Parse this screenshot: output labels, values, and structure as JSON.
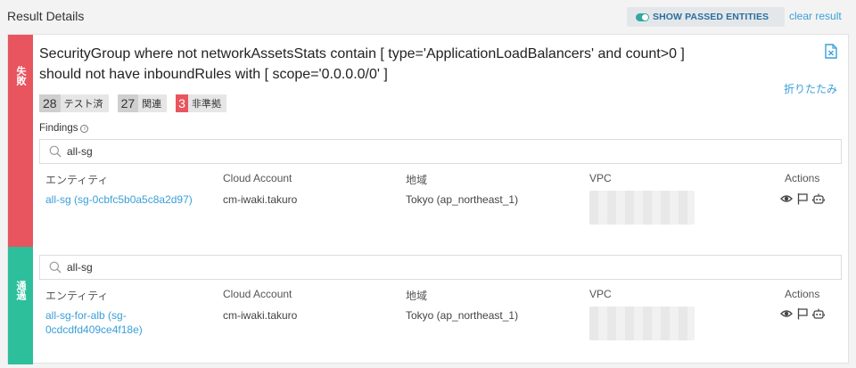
{
  "header": {
    "title": "Result Details",
    "show_passed_label": "SHOW PASSED ENTITIES",
    "clear_label": "clear result"
  },
  "rule": {
    "line1": "SecurityGroup where not networkAssetsStats contain [ type='ApplicationLoadBalancers' and count>0 ]",
    "line2": "should not have inboundRules with [ scope='0.0.0.0/0' ]",
    "collapse_label": "折りたたみ"
  },
  "stats": {
    "tested_count": "28",
    "tested_label": "テスト済",
    "related_count": "27",
    "related_label": "関連",
    "noncompliant_count": "3",
    "noncompliant_label": "非準拠"
  },
  "findings_label": "Findings",
  "columns": {
    "entity": "エンティティ",
    "account": "Cloud Account",
    "region": "地域",
    "vpc": "VPC",
    "actions": "Actions"
  },
  "failed_group": {
    "label": "失敗",
    "search_value": "all-sg",
    "row": {
      "entity": "all-sg (sg-0cbfc5b0a5c8a2d97)",
      "account": "cm-iwaki.takuro",
      "region": "Tokyo (ap_northeast_1)"
    }
  },
  "passed_group": {
    "label": "通過",
    "search_value": "all-sg",
    "row": {
      "entity": "all-sg-for-alb (sg-0cdcdfd409ce4f18e)",
      "account": "cm-iwaki.takuro",
      "region": "Tokyo (ap_northeast_1)"
    }
  },
  "colors": {
    "fail": "#e8555f",
    "pass": "#2dbf9c",
    "link": "#3a9fd9",
    "toggle_on": "#34a8a0"
  },
  "icons": [
    "toggle-icon",
    "document-icon",
    "info-icon",
    "search-icon",
    "eye-icon",
    "flag-icon",
    "bot-icon"
  ]
}
